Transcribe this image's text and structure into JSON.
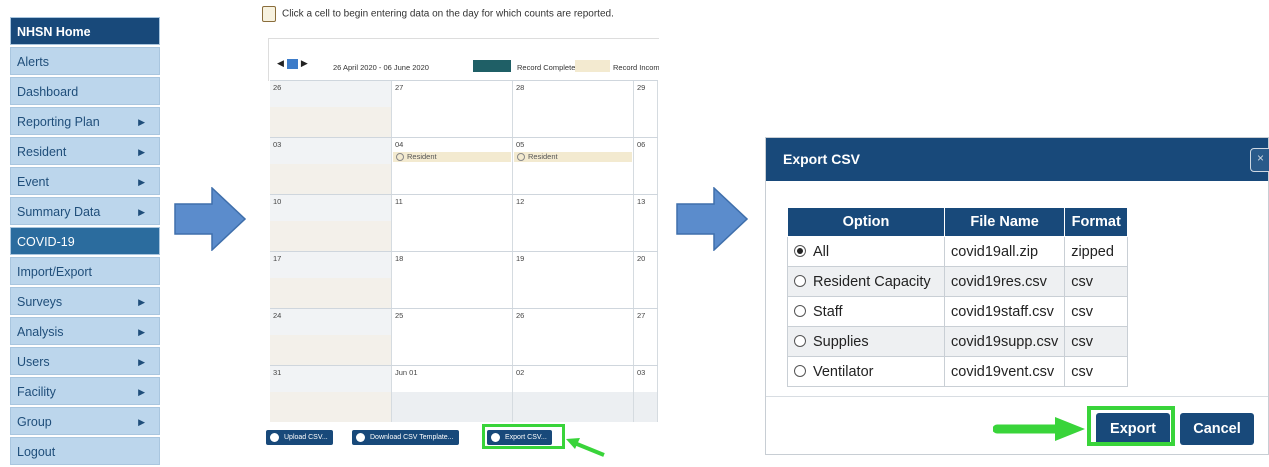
{
  "nav": {
    "items": [
      {
        "label": "NHSN Home",
        "caret": false
      },
      {
        "label": "Alerts",
        "caret": false
      },
      {
        "label": "Dashboard",
        "caret": false
      },
      {
        "label": "Reporting Plan",
        "caret": true
      },
      {
        "label": "Resident",
        "caret": true
      },
      {
        "label": "Event",
        "caret": true
      },
      {
        "label": "Summary Data",
        "caret": true
      },
      {
        "label": "COVID-19",
        "caret": false
      },
      {
        "label": "Import/Export",
        "caret": false
      },
      {
        "label": "Surveys",
        "caret": true
      },
      {
        "label": "Analysis",
        "caret": true
      },
      {
        "label": "Users",
        "caret": true
      },
      {
        "label": "Facility",
        "caret": true
      },
      {
        "label": "Group",
        "caret": true
      },
      {
        "label": "Logout",
        "caret": false
      }
    ],
    "caret_glyph": "▶"
  },
  "calendar": {
    "instruction": "Click a cell to begin entering data on the day for which counts are reported.",
    "nav_prev": "◀",
    "nav_next": "▶",
    "date_range": "26 April 2020 - 06 June 2020",
    "legend": {
      "complete_label": "Record Complete",
      "complete_color": "#1f5f66",
      "incomplete_label": "Record Incomplete",
      "incomplete_color": "#f3ead0"
    },
    "weeks": [
      [
        "26",
        "27",
        "28",
        "29"
      ],
      [
        "03",
        "04",
        "05",
        "06"
      ],
      [
        "10",
        "11",
        "12",
        "13"
      ],
      [
        "17",
        "18",
        "19",
        "20"
      ],
      [
        "24",
        "25",
        "26",
        "27"
      ],
      [
        "31",
        "Jun 01",
        "02",
        "03"
      ]
    ],
    "entry_label": "Resident",
    "buttons": {
      "upload": "Upload CSV...",
      "download": "Download CSV Template...",
      "export": "Export CSV..."
    }
  },
  "dialog": {
    "title": "Export CSV",
    "close_glyph": "×",
    "columns": {
      "option": "Option",
      "file_name": "File Name",
      "format": "Format"
    },
    "rows": [
      {
        "option": "All",
        "file_name": "covid19all.zip",
        "format": "zipped",
        "selected": true
      },
      {
        "option": "Resident Capacity",
        "file_name": "covid19res.csv",
        "format": "csv",
        "selected": false
      },
      {
        "option": "Staff",
        "file_name": "covid19staff.csv",
        "format": "csv",
        "selected": false
      },
      {
        "option": "Supplies",
        "file_name": "covid19supp.csv",
        "format": "csv",
        "selected": false
      },
      {
        "option": "Ventilator",
        "file_name": "covid19vent.csv",
        "format": "csv",
        "selected": false
      }
    ],
    "export_label": "Export",
    "cancel_label": "Cancel"
  },
  "colors": {
    "nav_bg": "#bcd6ec",
    "nav_home_bg": "#18497a",
    "nav_active_bg": "#2b6c9e",
    "dialog_header": "#18497a",
    "arrow_fill": "#5b8ccc",
    "highlight": "#39d43a"
  }
}
